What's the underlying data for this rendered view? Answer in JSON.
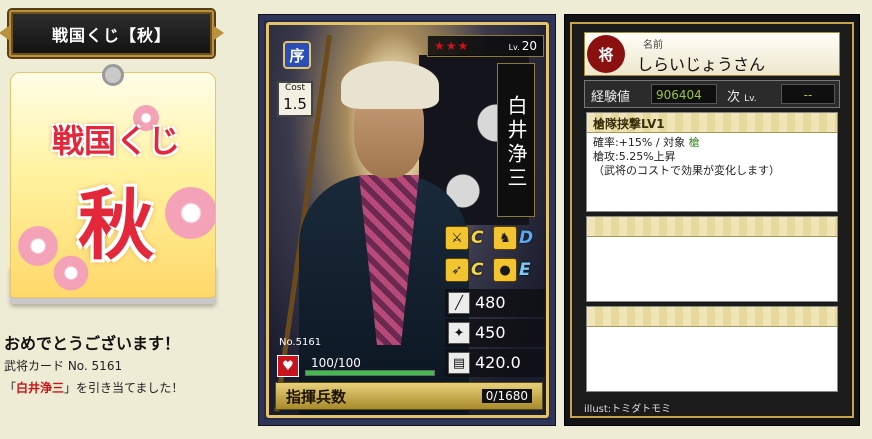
{
  "banner": {
    "title": "戦国くじ【秋】"
  },
  "lottery_ticket": {
    "title": "戦国くじ",
    "big_char": "秋"
  },
  "result": {
    "congrats": "おめでとうございます！",
    "card_line": "武将カード No. 5161",
    "drawn_prefix": "「",
    "drawn_name": "白井浄三",
    "drawn_suffix": "」を引き当てました！"
  },
  "card": {
    "rank": "序",
    "cost_label": "Cost",
    "cost": "1.5",
    "stars": "★★★",
    "lv_label": "Lv.",
    "level": "20",
    "name": "白井浄三",
    "aptitudes": [
      {
        "icon": "foot-soldier-icon",
        "grade": "C",
        "color": "#f1d64a"
      },
      {
        "icon": "cavalry-icon",
        "grade": "D",
        "color": "#5aa6f0"
      },
      {
        "icon": "bow-icon",
        "grade": "C",
        "color": "#f1d64a"
      },
      {
        "icon": "siege-icon",
        "grade": "E",
        "color": "#7cc7f7"
      }
    ],
    "stats": [
      {
        "icon": "attack-icon",
        "value": "480"
      },
      {
        "icon": "defense-icon",
        "value": "450"
      },
      {
        "icon": "intelligence-icon",
        "value": "420.0"
      }
    ],
    "card_no": "No.5161",
    "hp": "100/100",
    "hp_fraction": 1.0,
    "troops_label": "指揮兵数",
    "troops": "0/1680"
  },
  "info": {
    "rank_icon": "将",
    "name_label": "名前",
    "name": "しらいじょうさん",
    "exp_label": "経験値",
    "exp_value": "906404",
    "next_label": "次",
    "next_lv": "Lv.",
    "next_value": "--",
    "skills": [
      {
        "name": "槍隊挟撃LV1",
        "line1_a": "確率:+15% / 対象 ",
        "line1_b": "槍",
        "line2": "槍攻:5.25%上昇",
        "line3": "（武将のコストで効果が変化します）"
      },
      {
        "name": "",
        "line1_a": "",
        "line1_b": "",
        "line2": "",
        "line3": ""
      },
      {
        "name": "",
        "line1_a": "",
        "line1_b": "",
        "line2": "",
        "line3": ""
      }
    ],
    "illust": "illust:トミダトモミ"
  }
}
